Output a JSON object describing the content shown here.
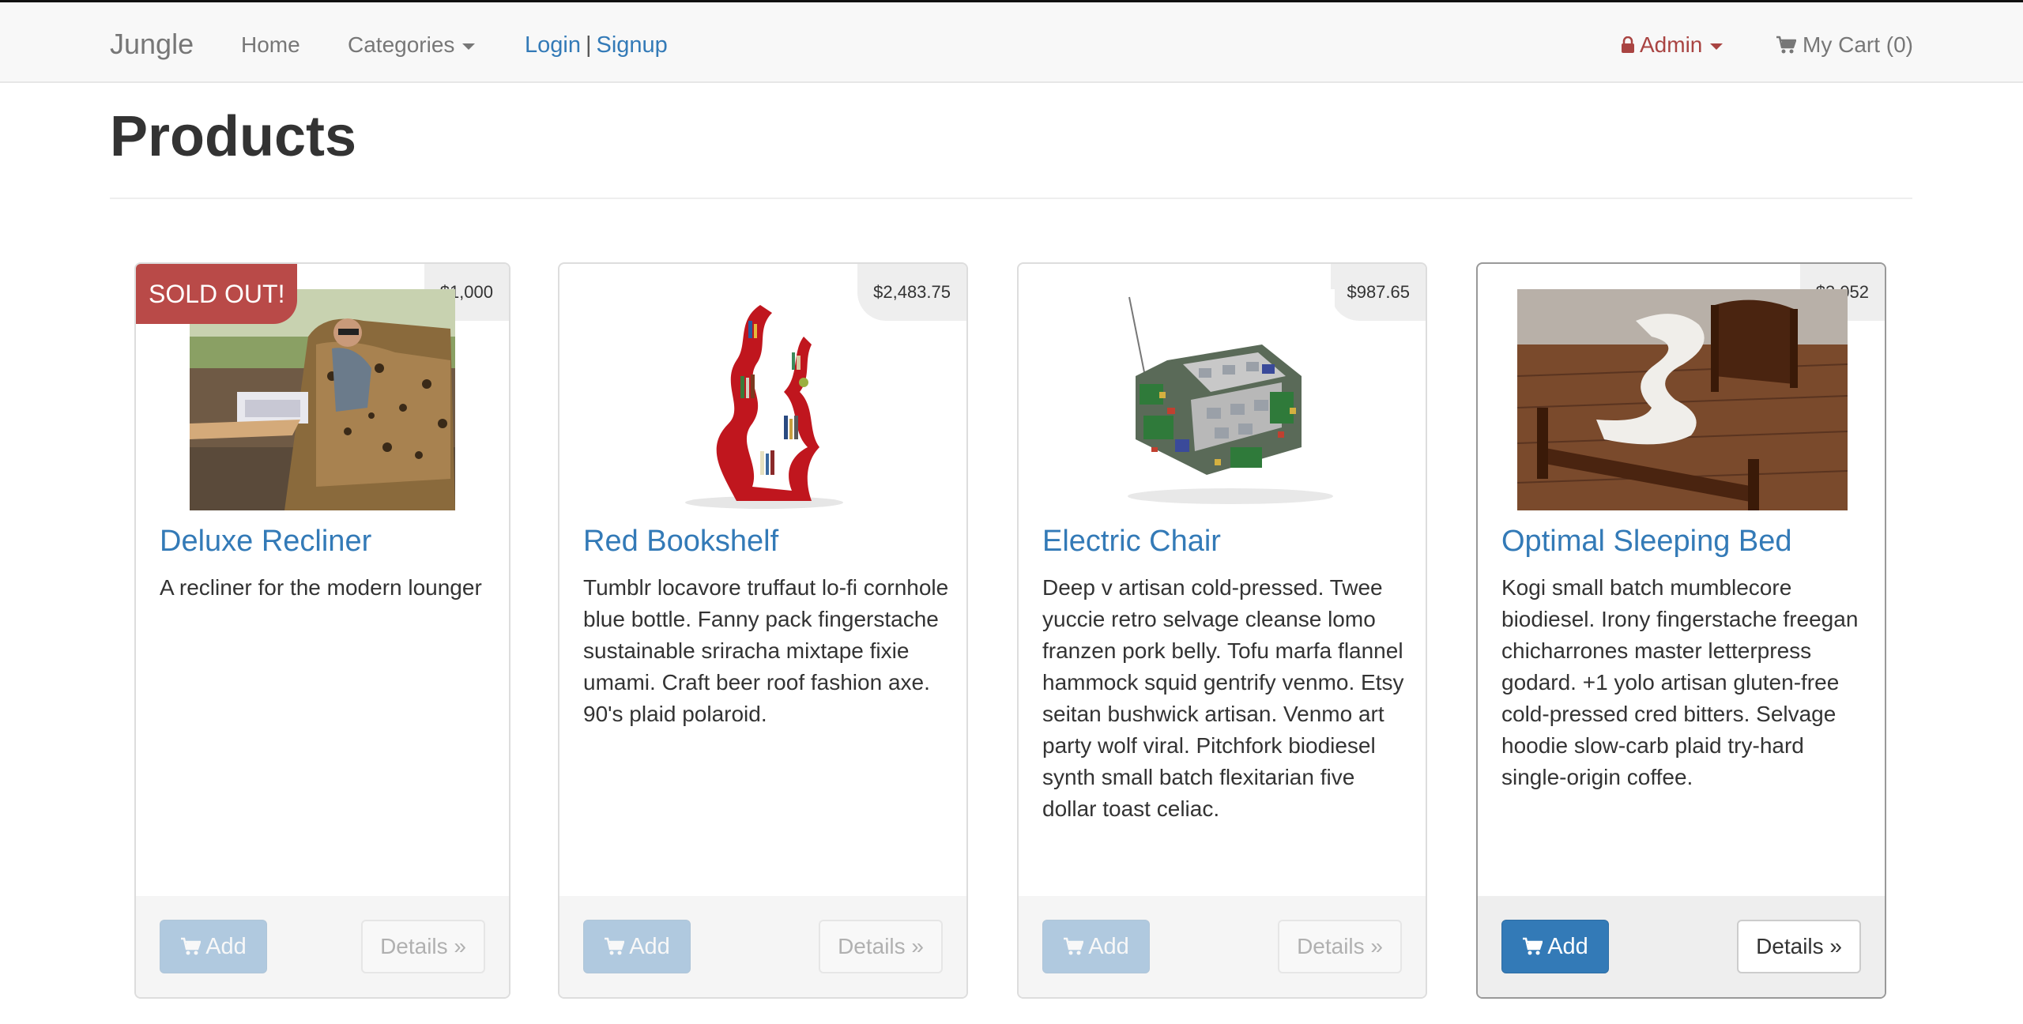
{
  "nav": {
    "brand": "Jungle",
    "home": "Home",
    "categories": "Categories",
    "login": "Login",
    "separator": "|",
    "signup": "Signup",
    "admin": "Admin",
    "cart": "My Cart (0)"
  },
  "page": {
    "title": "Products"
  },
  "buttons": {
    "add": "Add",
    "details": "Details »"
  },
  "products": [
    {
      "name": "Deluxe Recliner",
      "price": "$1,000",
      "badge": "SOLD OUT!",
      "description": "A recliner for the modern lounger",
      "sold_out": true
    },
    {
      "name": "Red Bookshelf",
      "price": "$2,483.75",
      "description": "Tumblr locavore truffaut lo-fi cornhole blue bottle. Fanny pack fingerstache sustainable sriracha mixtape fixie umami. Craft beer roof fashion axe. 90's plaid polaroid.",
      "sold_out": false
    },
    {
      "name": "Electric Chair",
      "price": "$987.65",
      "description": "Deep v artisan cold-pressed. Twee yuccie retro selvage cleanse lomo franzen pork belly. Tofu marfa flannel hammock squid gentrify venmo. Etsy seitan bushwick artisan. Venmo art party wolf viral. Pitchfork biodiesel synth small batch flexitarian five dollar toast celiac.",
      "sold_out": false
    },
    {
      "name": "Optimal Sleeping Bed",
      "price": "$3,052",
      "description": "Kogi small batch mumblecore biodiesel. Irony fingerstache freegan chicharrones master letterpress godard. +1 yolo artisan gluten-free cold-pressed cred bitters. Selvage hoodie slow-carb plaid try-hard single-origin coffee.",
      "sold_out": false
    }
  ],
  "colors": {
    "link": "#337ab7",
    "sold_out": "#b94a48",
    "admin": "#a94442",
    "primary_button": "#337ab7"
  }
}
